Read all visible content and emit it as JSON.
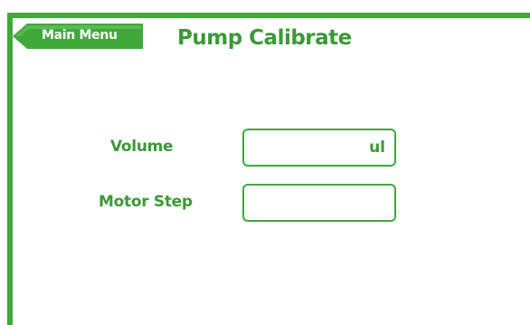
{
  "header": {
    "back_button_label": "Main Menu",
    "page_title": "Pump Calibrate"
  },
  "form": {
    "volume": {
      "label": "Volume",
      "value": "",
      "unit": "ul"
    },
    "motor_step": {
      "label": "Motor Step",
      "value": ""
    }
  },
  "colors": {
    "accent_green": "#3fa93a",
    "text_green": "#3a9a35",
    "background": "#ffffff"
  },
  "icons": {
    "back_button_shape": "left-arrow-tab"
  }
}
